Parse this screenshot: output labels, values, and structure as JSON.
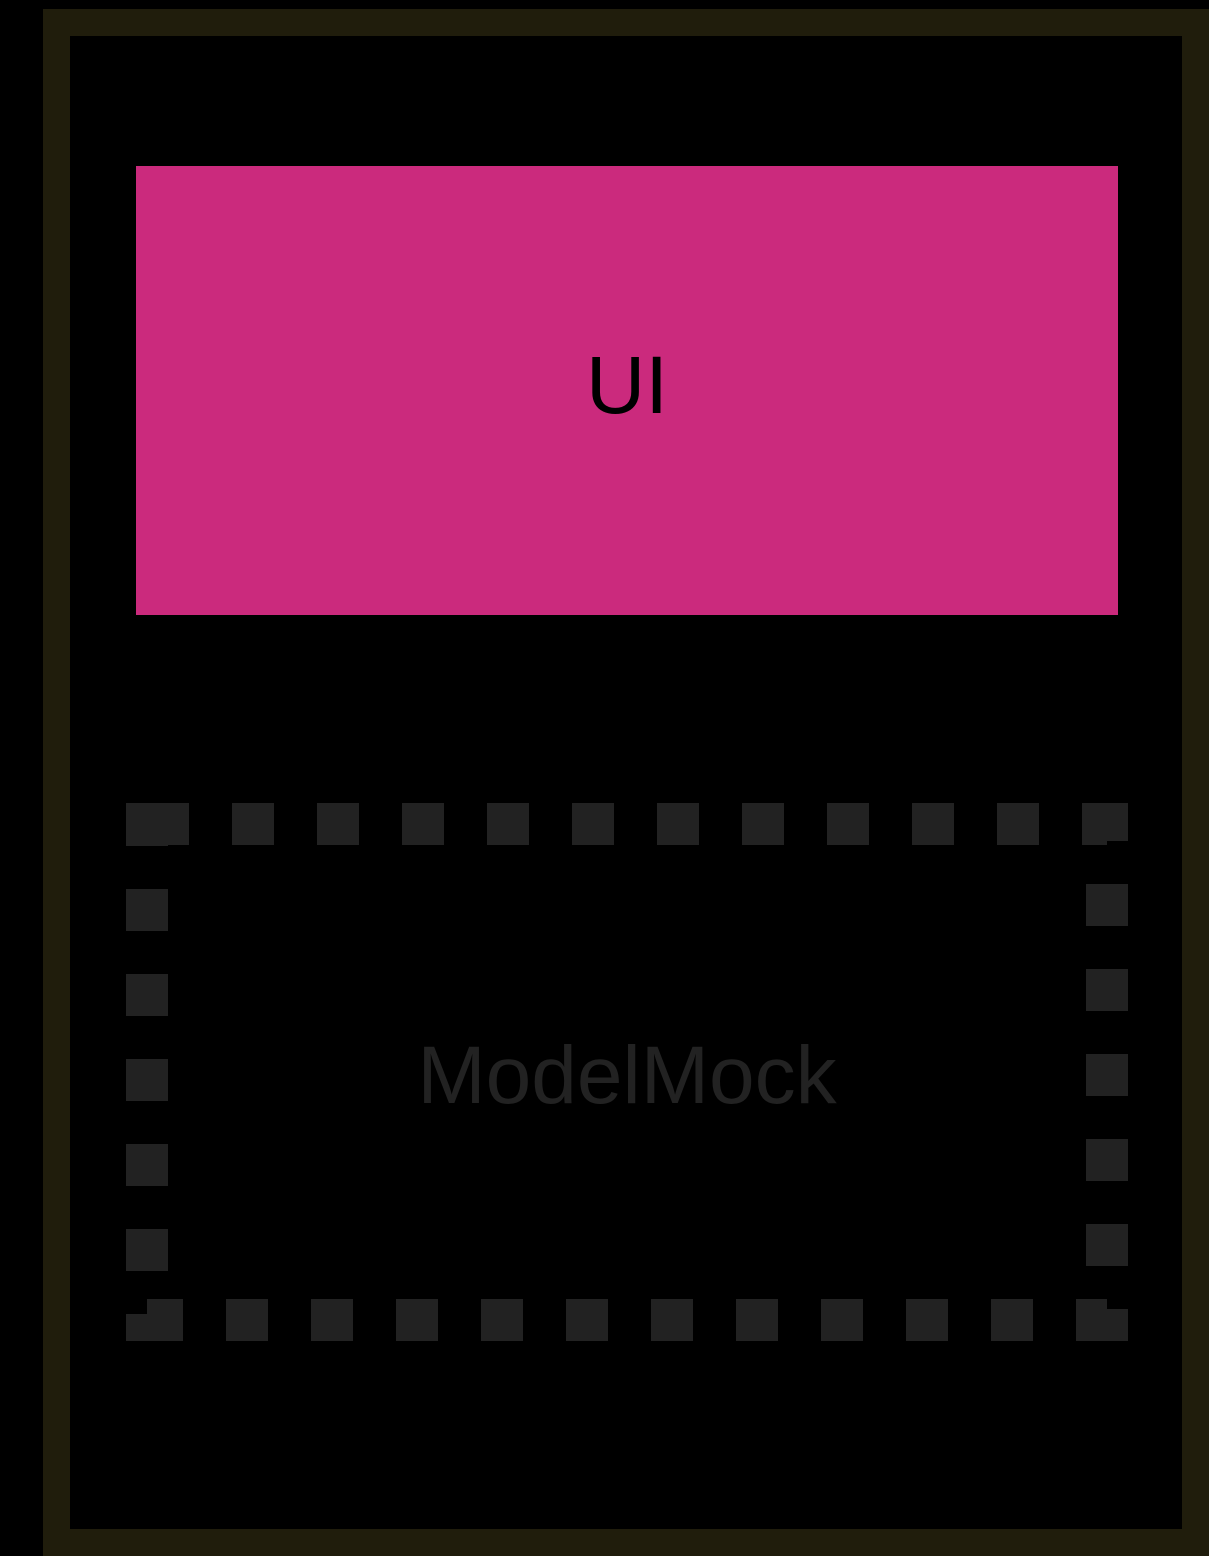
{
  "diagram": {
    "ui_box": {
      "label": "UI",
      "color": "#cb2a7d"
    },
    "mock_box": {
      "label": "ModelMock",
      "border_style": "dashed",
      "color": "#222222"
    },
    "frame": {
      "color": "#201d0c"
    }
  }
}
